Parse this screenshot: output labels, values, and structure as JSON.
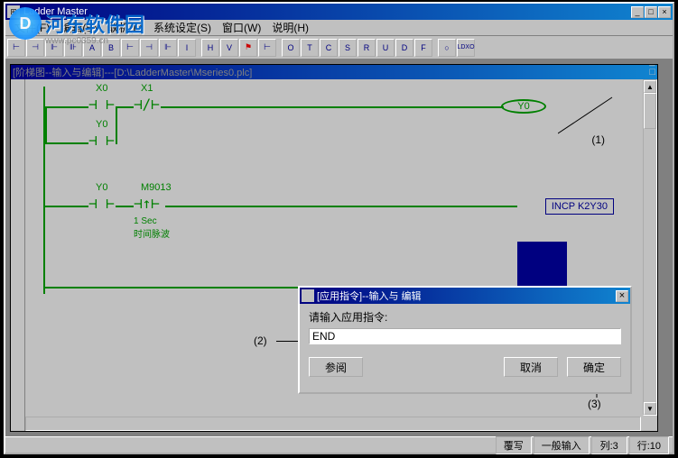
{
  "app": {
    "title": "Ladder Master"
  },
  "menu": {
    "items": [
      "文件(F)",
      "编辑(E)",
      "联机(L)",
      "系统设定(S)",
      "窗口(W)",
      "说明(H)"
    ]
  },
  "toolbar": {
    "buttons": [
      "H",
      "A",
      "B",
      "H",
      "H",
      "H",
      "I",
      "H",
      "V",
      "H",
      "O",
      "T",
      "C",
      "S",
      "R",
      "U",
      "D",
      "F",
      "O",
      "H"
    ]
  },
  "doc": {
    "title": "[阶梯图--输入与编辑]---[D:\\LadderMaster\\Mseries0.plc]"
  },
  "ladder": {
    "contacts": [
      {
        "label": "X0"
      },
      {
        "label": "X1"
      },
      {
        "label": "Y0"
      },
      {
        "label": "Y0"
      },
      {
        "label": "M9013"
      }
    ],
    "coil": "Y0",
    "instruction": "INCP K2Y30",
    "timer_note1": "1 Sec",
    "timer_note2": "时间脉波"
  },
  "annotations": {
    "a1": "(1)",
    "a2": "(2)",
    "a3": "(3)"
  },
  "dialog": {
    "title": "[应用指令]--输入与 编辑",
    "prompt": "请输入应用指令:",
    "value": "END",
    "btn_ref": "参阅",
    "btn_cancel": "取消",
    "btn_ok": "确定"
  },
  "status": {
    "cells": [
      "覆写",
      "一般输入",
      "列:3",
      "行:10"
    ]
  },
  "watermark": {
    "logo": "D",
    "text": "河东软件园",
    "url": "www.pc0359.cn"
  }
}
